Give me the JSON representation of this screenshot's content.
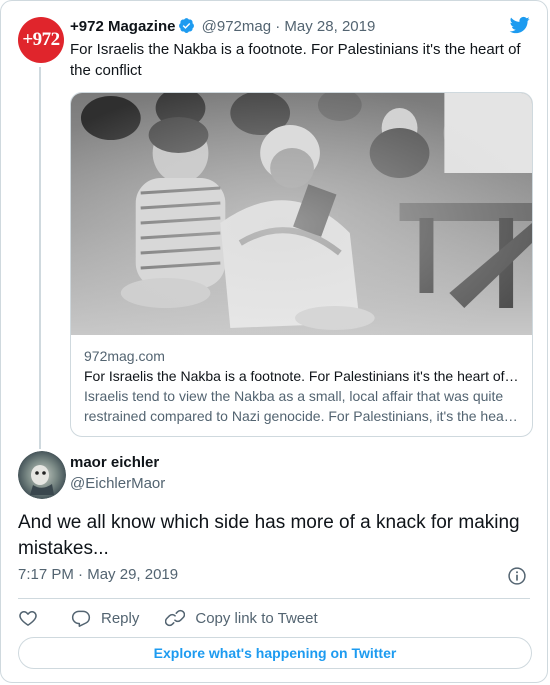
{
  "parent_tweet": {
    "avatar_text": "+972",
    "display_name": "+972 Magazine",
    "handle": "@972mag",
    "separator": "·",
    "date": "May 28, 2019",
    "text": "For Israelis the Nakba is a footnote. For Palestinians it's the heart of the conflict",
    "link_card": {
      "domain": "972mag.com",
      "title": "For Israelis the Nakba is a footnote. For Palestinians it's the heart of the conflict",
      "description": "Israelis tend to view the Nakba as a small, local affair that was quite restrained compared to Nazi genocide. For Palestinians, it's the heart of the conflict."
    }
  },
  "tweet": {
    "display_name": "maor eichler",
    "handle": "@EichlerMaor",
    "text": "And we all know which side has more of a knack for making mistakes...",
    "time": "7:17 PM",
    "separator": "·",
    "date": "May 29, 2019"
  },
  "actions": {
    "reply_label": "Reply",
    "copy_link_label": "Copy link to Tweet"
  },
  "explore_label": "Explore what's happening on Twitter",
  "colors": {
    "twitter_blue": "#1d9bf0",
    "text_primary": "#0f1419",
    "text_secondary": "#536471",
    "border": "#cfd9de",
    "brand_972_red": "#e0252c"
  },
  "icons": [
    "twitter-logo-icon",
    "verified-badge-icon",
    "info-icon",
    "heart-icon",
    "reply-icon",
    "link-icon"
  ]
}
